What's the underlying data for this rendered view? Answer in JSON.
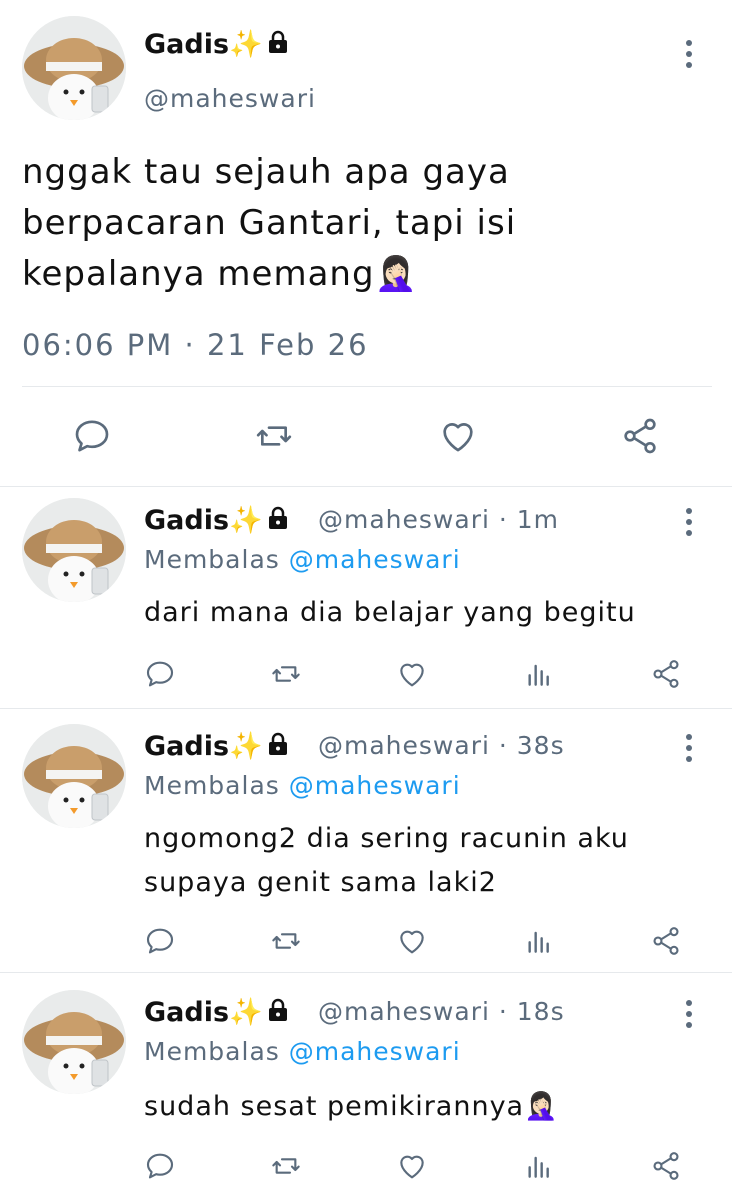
{
  "main_tweet": {
    "display_name": "Gadis",
    "handle": "@maheswari",
    "text_line1": "nggak tau sejauh apa gaya",
    "text_line2": "berpacaran Gantari, tapi isi",
    "text_line3": "kepalanya memang🤦🏻‍♀️",
    "timestamp": "06:06 PM · 21 Feb 26"
  },
  "replies": [
    {
      "display_name": "Gadis",
      "handle": "@maheswari",
      "age": "· 1m",
      "reply_prefix": "Membalas ",
      "reply_to": "@maheswari",
      "lines": [
        "dari mana dia belajar yang begitu"
      ]
    },
    {
      "display_name": "Gadis",
      "handle": "@maheswari",
      "age": "· 38s",
      "reply_prefix": "Membalas ",
      "reply_to": "@maheswari",
      "lines": [
        "ngomong2 dia sering racunin aku",
        "supaya genit sama laki2"
      ]
    },
    {
      "display_name": "Gadis",
      "handle": "@maheswari",
      "age": "· 18s",
      "reply_prefix": "Membalas ",
      "reply_to": "@maheswari",
      "lines": [
        "sudah sesat pemikirannya🤦🏻‍♀️"
      ]
    }
  ],
  "theme": {
    "muted": "#5b6b7c",
    "link": "#1d9bf0",
    "divider": "#e6e9ec"
  },
  "icons": [
    "sparkles-icon",
    "lock-icon",
    "more-vertical-icon",
    "reply-icon",
    "retweet-icon",
    "like-icon",
    "analytics-icon",
    "share-icon"
  ]
}
